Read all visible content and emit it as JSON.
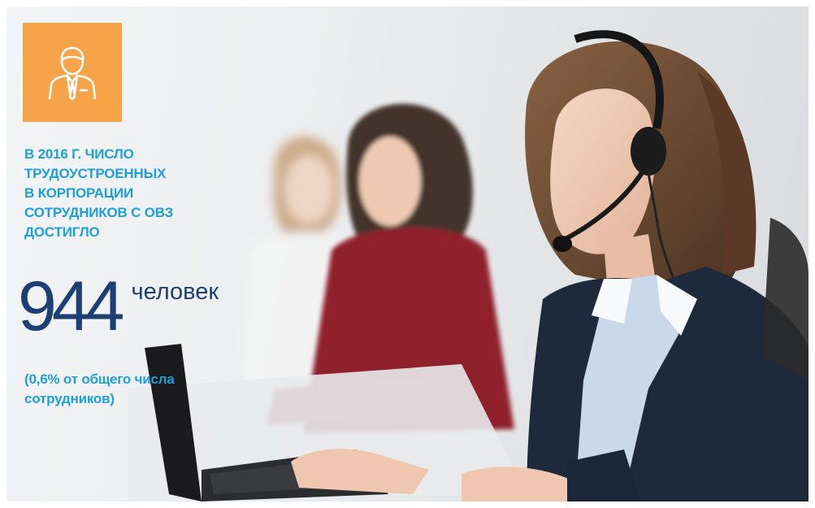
{
  "infographic": {
    "icon": "businessman-icon",
    "accent_color": "#f7a347",
    "caption_color": "#1f9fd9",
    "number_color": "#1d3f73",
    "caption_lines": [
      "В 2016 г. число",
      "трудоустроенных",
      "в корпорации",
      "сотрудников с ОВЗ",
      "достигло"
    ],
    "value": "944",
    "unit": "человек",
    "note_lines": [
      "(0,6% от общего числа",
      "сотрудников)"
    ]
  }
}
